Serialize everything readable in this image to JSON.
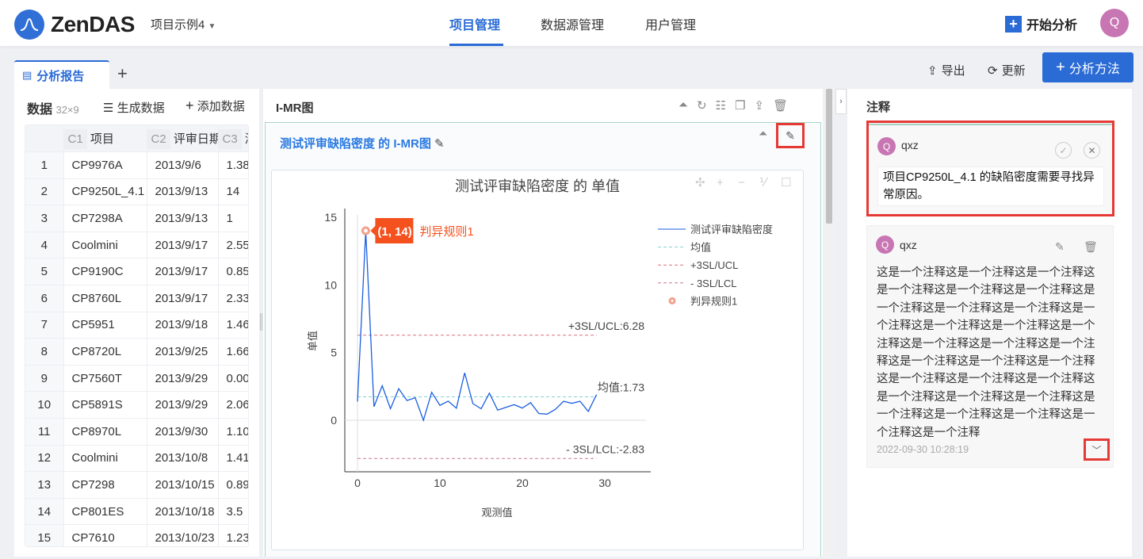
{
  "header": {
    "logo": "ZenDAS",
    "project": "项目示例4",
    "nav": [
      "项目管理",
      "数据源管理",
      "用户管理"
    ],
    "start": "开始分析",
    "user_initial": "Q"
  },
  "tabs": {
    "active": "分析报告",
    "add": "+",
    "export": "导出",
    "refresh": "更新",
    "analyze": "分析方法"
  },
  "data_panel": {
    "title": "数据",
    "dims": "32×9",
    "generate": "生成数据",
    "add": "添加数据",
    "columns": [
      {
        "id": "C1",
        "name": "项目"
      },
      {
        "id": "C2",
        "name": "评审日期"
      },
      {
        "id": "C3",
        "name": "测"
      }
    ],
    "rows": [
      [
        "1",
        "CP9976A",
        "2013/9/6",
        "1.38"
      ],
      [
        "2",
        "CP9250L_4.1",
        "2013/9/13",
        "14"
      ],
      [
        "3",
        "CP7298A",
        "2013/9/13",
        "1"
      ],
      [
        "4",
        "Coolmini",
        "2013/9/17",
        "2.55"
      ],
      [
        "5",
        "CP9190C",
        "2013/9/17",
        "0.85"
      ],
      [
        "6",
        "CP8760L",
        "2013/9/17",
        "2.33"
      ],
      [
        "7",
        "CP5951",
        "2013/9/18",
        "1.46"
      ],
      [
        "8",
        "CP8720L",
        "2013/9/25",
        "1.66"
      ],
      [
        "9",
        "CP7560T",
        "2013/9/29",
        "0.00"
      ],
      [
        "10",
        "CP5891S",
        "2013/9/29",
        "2.06"
      ],
      [
        "11",
        "CP8970L",
        "2013/9/30",
        "1.10"
      ],
      [
        "12",
        "Coolmini",
        "2013/10/8",
        "1.41"
      ],
      [
        "13",
        "CP7298",
        "2013/10/15",
        "0.89"
      ],
      [
        "14",
        "CP801ES",
        "2013/10/18",
        "3.5"
      ],
      [
        "15",
        "CP7610",
        "2013/10/23",
        "1.23"
      ]
    ]
  },
  "chart_panel": {
    "title": "I-MR图",
    "card_title": "测试评审缺陷密度 的 I-MR图"
  },
  "chart_data": {
    "type": "line",
    "title": "测试评审缺陷密度  的 单值",
    "xlabel": "观测值",
    "ylabel": "单值",
    "xlim": [
      0,
      35
    ],
    "ylim": [
      -3.8,
      15
    ],
    "xticks": [
      "0",
      "10",
      "20",
      "30"
    ],
    "yticks": [
      "0",
      "5",
      "10",
      "15"
    ],
    "series": [
      {
        "name": "测试评审缺陷密度",
        "color": "#1a5fe0",
        "x": [
          0,
          1,
          2,
          3,
          4,
          5,
          6,
          7,
          8,
          9,
          10,
          11,
          12,
          13,
          14,
          15,
          16,
          17,
          18,
          19,
          20,
          21,
          22,
          23,
          24,
          25,
          26,
          27,
          28,
          29
        ],
        "values": [
          1.38,
          14,
          1,
          2.55,
          0.85,
          2.33,
          1.46,
          1.66,
          0,
          2.06,
          1.1,
          1.41,
          0.89,
          3.5,
          1.23,
          0.85,
          2.0,
          0.75,
          0.95,
          1.15,
          0.9,
          1.3,
          0.5,
          0.45,
          0.8,
          1.4,
          1.25,
          1.4,
          0.65,
          1.9
        ]
      }
    ],
    "lines": [
      {
        "name": "均值",
        "value": 1.73,
        "label": "均值:1.73",
        "color": "#7fd3cf"
      },
      {
        "name": "+3SL/UCL",
        "value": 6.28,
        "label": "+3SL/UCL:6.28",
        "color": "#d9707a"
      },
      {
        "name": "- 3SL/LCL",
        "value": -2.83,
        "label": "- 3SL/LCL:-2.83",
        "color": "#c97a8a"
      }
    ],
    "rule_points": [
      {
        "name": "判异规则1",
        "x": 1,
        "y": 14,
        "tag": "(1, 14)",
        "label": "判异规则1",
        "color": "#f4511e"
      }
    ],
    "legend": "top-right"
  },
  "notes": {
    "title": "注释",
    "items": [
      {
        "user": "qxz",
        "initial": "Q",
        "text": "项目CP9250L_4.1 的缺陷密度需要寻找异常原因。"
      },
      {
        "user": "qxz",
        "initial": "Q",
        "text": "这是一个注释这是一个注释这是一个注释这是一个注释这是一个注释这是一个注释这是一个注释这是一个注释这是一个注释这是一个注释这是一个注释这是一个注释这是一个注释这是一个注释这是一个注释这是一个注释这是一个注释这是一个注释这是一个注释这是一个注释这是一个注释这是一个注释这是一个注释这是一个注释这是一个注释这是一个注释这是一个注释这是一个注释这是一个注释这是一个注释",
        "time": "2022-09-30 10:28:19"
      }
    ]
  }
}
